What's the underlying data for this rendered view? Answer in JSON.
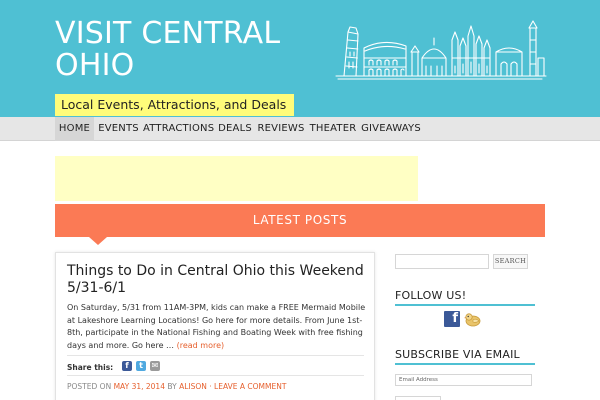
{
  "site": {
    "title": "VISIT CENTRAL OHIO",
    "tagline": "Local Events, Attractions, and Deals"
  },
  "nav": {
    "items": [
      {
        "label": "HOME",
        "active": true
      },
      {
        "label": "EVENTS"
      },
      {
        "label": "ATTRACTIONS"
      },
      {
        "label": "DEALS"
      },
      {
        "label": "REVIEWS"
      },
      {
        "label": "THEATER"
      },
      {
        "label": "GIVEAWAYS"
      }
    ]
  },
  "latest": {
    "heading": "LATEST POSTS"
  },
  "post": {
    "title": "Things to Do in Central Ohio this Weekend 5/31-6/1",
    "excerpt": "On Saturday, 5/31 from 11AM-3PM, kids can make a FREE Mermaid Mobile at Lakeshore Learning Locations! Go here for more details. From June 1st-8th, participate in the National Fishing and Boating Week with free fishing days and more. Go here …",
    "read_more": "(read more)",
    "share_label": "Share this:",
    "meta": {
      "posted_on": "POSTED ON",
      "date": "MAY 31, 2014",
      "by": "BY",
      "author": "ALISON",
      "separator": "·",
      "comment": "LEAVE A COMMENT"
    }
  },
  "sidebar": {
    "search_button": "SEARCH",
    "follow_title": "FOLLOW US!",
    "subscribe_title": "SUBSCRIBE VIA EMAIL",
    "email_placeholder": "Email Address"
  },
  "colors": {
    "header_bg": "#4fc0d3",
    "tagline_bg": "#fffc7a",
    "latest_bar": "#fb7a55",
    "accent_link": "#e6602e",
    "ad_bg": "#ffffc4",
    "facebook": "#3b5998"
  }
}
